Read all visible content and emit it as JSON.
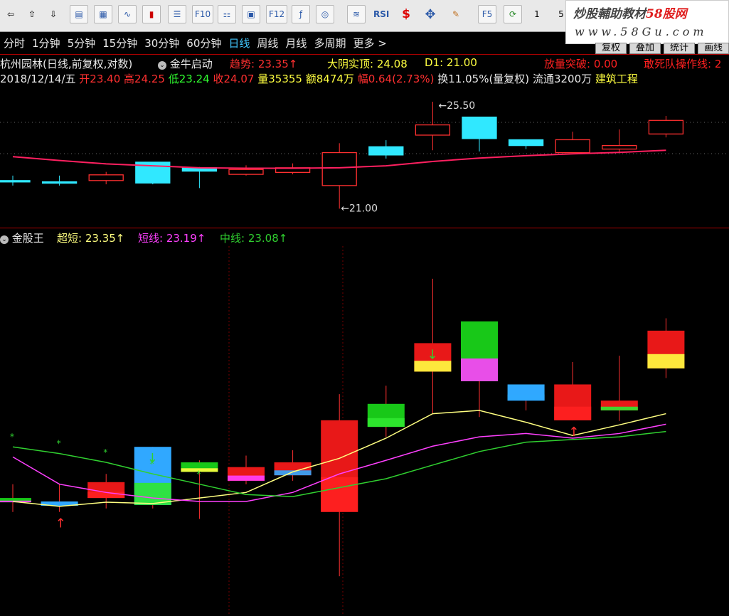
{
  "toolbar": {
    "numbers": [
      "1",
      "5"
    ],
    "labels": [
      "F10",
      "F12",
      "RSI",
      "F5"
    ]
  },
  "watermark": {
    "line1_a": "炒股輔助教材",
    "line1_b": "58股网",
    "line2": "www.58Gu.com"
  },
  "period_tabs": [
    "分时",
    "1分钟",
    "5分钟",
    "15分钟",
    "30分钟",
    "60分钟",
    "日线",
    "周线",
    "月线",
    "多周期",
    "更多 >"
  ],
  "active_tab": "日线",
  "right_tabs": [
    "复权",
    "叠加",
    "统计",
    "画线"
  ],
  "main_header": {
    "title": "杭州园林(日线,前复权,对数)",
    "indicator": "金牛启动",
    "trend_label": "趋势: 23.35↑",
    "yang_label": "大阴实顶: 24.08",
    "d1_label": "D1: 21.00",
    "volume_break": "放量突破: 0.00",
    "dare_die": "敢死队操作线: 2"
  },
  "quote_line": {
    "date": "2018/12/14/五",
    "open": "开23.40",
    "high": "高24.25",
    "low": "低23.24",
    "close": "收24.07",
    "volume": "量35355",
    "amount": "额8474万",
    "change": "幅0.64(2.73%)",
    "turnover": "换11.05%(量复权)",
    "float": "流通3200万",
    "industry": "建筑工程"
  },
  "sub_header": {
    "name": "金股王",
    "ultra_short": "超短: 23.35↑",
    "short": "短线: 23.19↑",
    "mid": "中线: 23.08↑"
  },
  "colors": {
    "up": "#ff3030",
    "down_fill": "#30e8ff",
    "ma": "#ff2060",
    "ultra": "#ffff80",
    "short": "#ff40ff",
    "mid": "#30d030"
  },
  "chart_data": [
    {
      "type": "candlestick",
      "title": "杭州园林(日线,前复权,对数)",
      "annotations": [
        "25.50",
        "21.00"
      ],
      "x": [
        "d1",
        "d2",
        "d3",
        "d4",
        "d5",
        "d6",
        "d7",
        "d8",
        "d9",
        "d10",
        "d11",
        "d12",
        "d13",
        "d14",
        "d15"
      ],
      "open": [
        22.1,
        22.05,
        22.1,
        22.85,
        22.62,
        22.35,
        22.43,
        21.9,
        23.5,
        24.0,
        24.8,
        23.8,
        23.25,
        23.4,
        24.05
      ],
      "close": [
        22.08,
        22.02,
        22.33,
        22.0,
        22.48,
        22.55,
        22.62,
        23.25,
        23.15,
        24.45,
        23.85,
        23.55,
        23.8,
        23.55,
        24.65
      ],
      "high": [
        22.3,
        22.3,
        22.45,
        22.85,
        22.65,
        22.72,
        22.8,
        23.65,
        23.78,
        25.5,
        24.35,
        23.75,
        24.15,
        24.25,
        24.85
      ],
      "low": [
        21.9,
        21.9,
        21.95,
        21.95,
        21.8,
        22.3,
        22.35,
        21.0,
        23.0,
        23.35,
        23.3,
        23.4,
        23.25,
        23.24,
        23.9
      ],
      "ma_line": [
        23.08,
        22.92,
        22.78,
        22.7,
        22.62,
        22.6,
        22.6,
        22.62,
        22.7,
        22.88,
        23.02,
        23.12,
        23.2,
        23.26,
        23.35
      ],
      "ylim": [
        20.5,
        26.0
      ]
    },
    {
      "type": "candlestick",
      "title": "金股王",
      "series_names": [
        "超短",
        "短线",
        "中线"
      ],
      "x": [
        "d1",
        "d2",
        "d3",
        "d4",
        "d5",
        "d6",
        "d7",
        "d8",
        "d9",
        "d10",
        "d11",
        "d12",
        "d13",
        "d14",
        "d15"
      ],
      "ultra": [
        22.05,
        21.98,
        22.04,
        22.02,
        22.1,
        22.18,
        22.48,
        22.68,
        22.98,
        23.35,
        23.4,
        23.22,
        23.02,
        23.18,
        23.35
      ],
      "short": [
        22.7,
        22.3,
        22.18,
        22.1,
        22.05,
        22.05,
        22.18,
        22.45,
        22.65,
        22.86,
        23.0,
        23.05,
        22.98,
        23.05,
        23.19
      ],
      "mid": [
        22.85,
        22.75,
        22.62,
        22.45,
        22.3,
        22.15,
        22.12,
        22.25,
        22.38,
        22.58,
        22.78,
        22.92,
        22.96,
        23.0,
        23.08
      ],
      "ylim": [
        20.5,
        26.0
      ]
    }
  ]
}
